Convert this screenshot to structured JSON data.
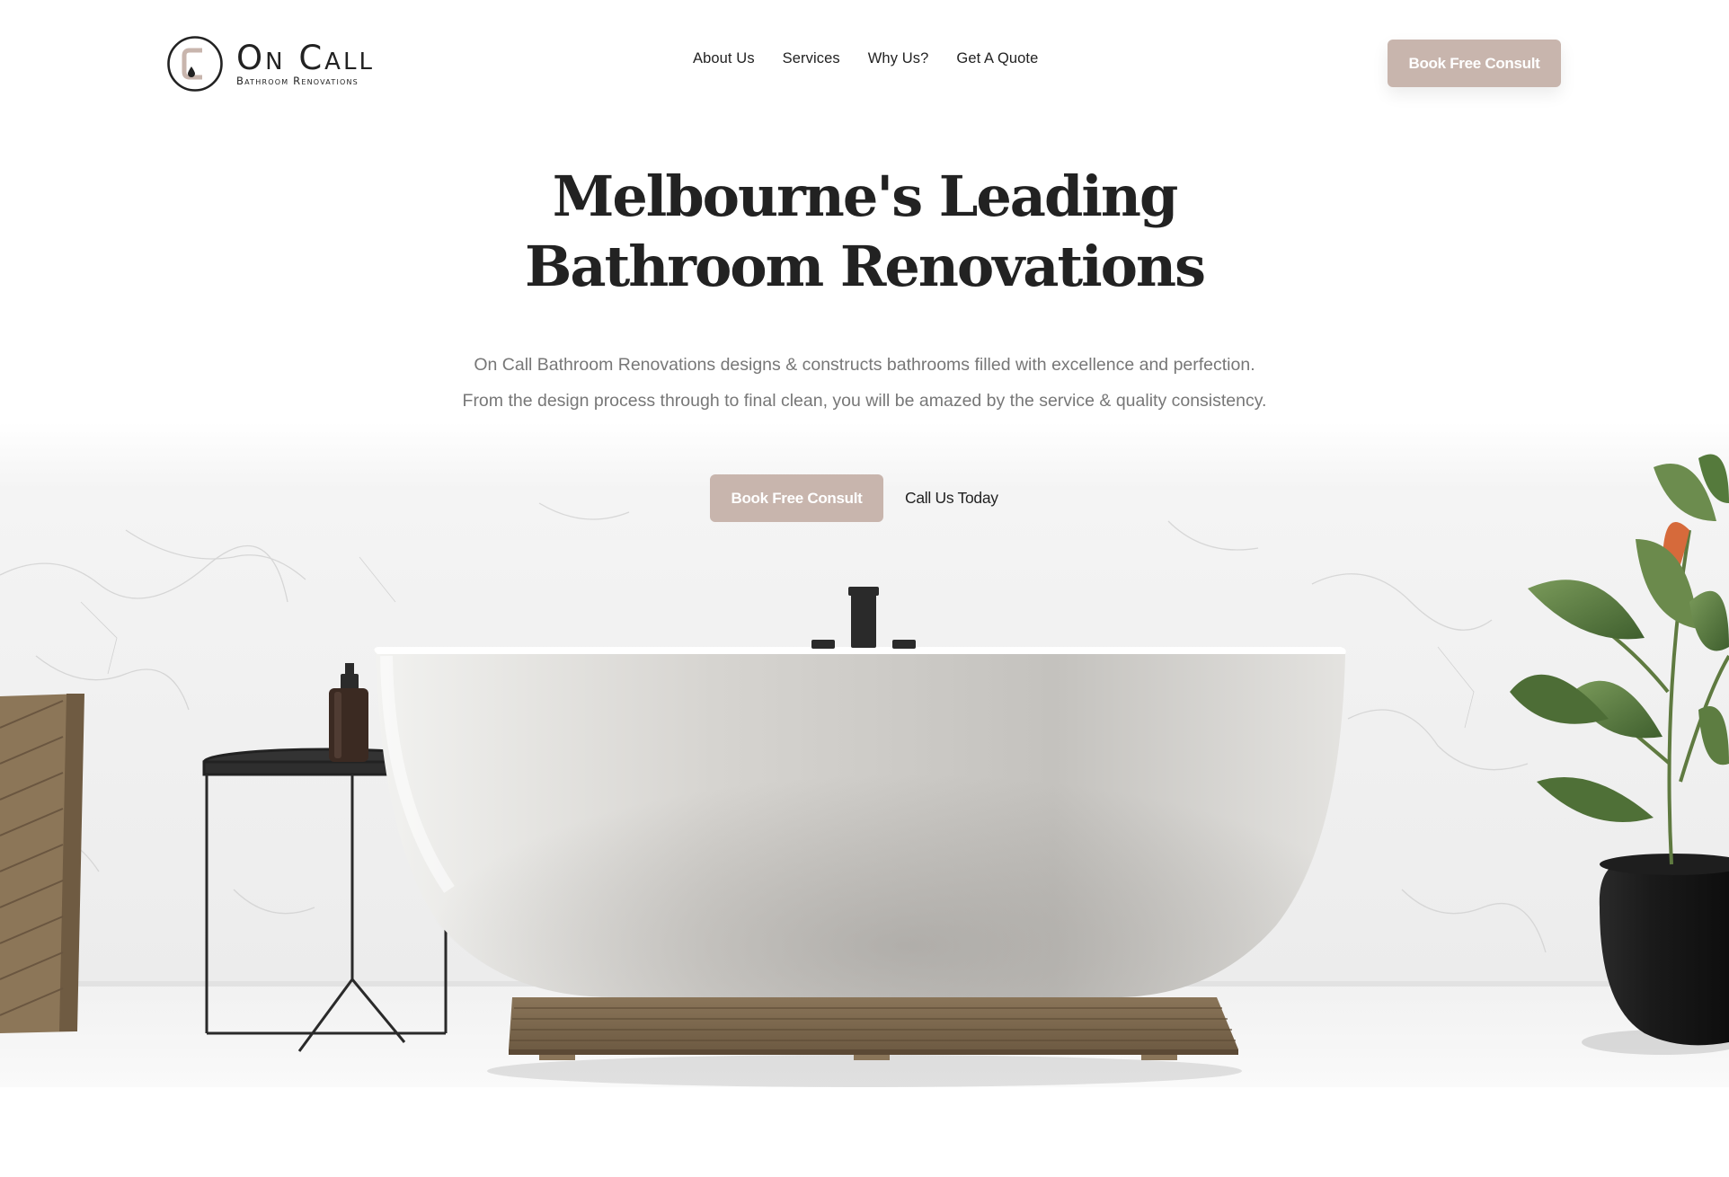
{
  "brand": {
    "name": "On Call",
    "tagline": "Bathroom Renovations"
  },
  "nav": {
    "items": [
      {
        "label": "About Us"
      },
      {
        "label": "Services"
      },
      {
        "label": "Why Us?"
      },
      {
        "label": "Get A Quote"
      }
    ],
    "cta_label": "Book Free Consult"
  },
  "hero": {
    "title_line1": "Melbourne's Leading",
    "title_line2": "Bathroom Renovations",
    "subtitle_line1": "On Call Bathroom Renovations designs & constructs bathrooms filled with excellence and perfection.",
    "subtitle_line2": "From the design process through to final clean, you will be amazed by the service & quality consistency.",
    "primary_cta": "Book Free Consult",
    "secondary_cta": "Call Us Today"
  },
  "colors": {
    "accent": "#c8b5ad",
    "text_dark": "#222222",
    "text_muted": "#777777",
    "background": "#ffffff"
  },
  "icons": {
    "logo": "bathroom-logo-icon"
  }
}
